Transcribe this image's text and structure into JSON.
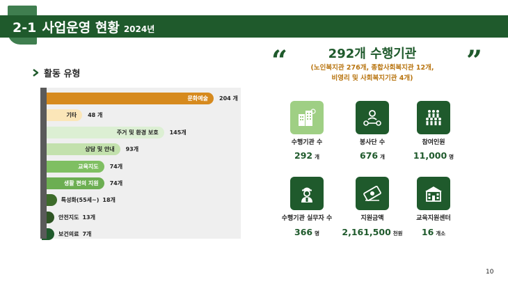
{
  "header": {
    "number": "2-1",
    "title": "사업운영 현황",
    "year": "2024년"
  },
  "section": {
    "label": "활동 유형"
  },
  "chart_data": {
    "type": "bar",
    "title": "",
    "categories": [
      "문화예술",
      "기타",
      "주거 및 환경 보호",
      "상담 및 안내",
      "교육지도",
      "생활 편의 지원",
      "특성화(55세~)",
      "안전지도",
      "보건의료"
    ],
    "values": [
      204,
      48,
      145,
      93,
      74,
      74,
      18,
      13,
      7
    ],
    "value_labels": [
      "204 개",
      "48 개",
      "145개",
      "93개",
      "74개",
      "74개",
      "18개",
      "13개",
      "7개"
    ],
    "colors": [
      "#d68a1e",
      "#fbe6b8",
      "#dcefd3",
      "#c3e1ad",
      "#7fbf62",
      "#6cae52",
      "#3d6b2a",
      "#2e5424",
      "#1f5a2c"
    ],
    "label_colors": [
      "#ffffff",
      "#222222",
      "#222222",
      "#222222",
      "#ffffff",
      "#ffffff",
      "#222222",
      "#222222",
      "#222222"
    ],
    "label_inside": [
      true,
      true,
      true,
      true,
      true,
      true,
      false,
      false,
      false
    ],
    "xlim": [
      0,
      204
    ],
    "grid": false
  },
  "summary": {
    "open_quote": "“",
    "close_quote": "”",
    "title": "292개 수행기관",
    "sub_line1": "(노인복지관 276개, 종합사회복지관 12개,",
    "sub_line2": "비영리 및 사회복지기관 4개)"
  },
  "stats": [
    {
      "label": "수행기관 수",
      "value": "292",
      "unit": "개",
      "icon": "buildings-icon",
      "color": "#9fcf84"
    },
    {
      "label": "봉사단 수",
      "value": "676",
      "unit": "개",
      "icon": "group-network-icon",
      "color": "#1f5a2c"
    },
    {
      "label": "참여인원",
      "value": "11,000",
      "unit": "명",
      "icon": "crowd-icon",
      "color": "#1f5a2c"
    },
    {
      "label": "수행기관 실무자 수",
      "value": "366",
      "unit": "명",
      "icon": "worker-icon",
      "color": "#1f5a2c"
    },
    {
      "label": "지원금액",
      "value": "2,161,500",
      "unit": "천원",
      "icon": "money-icon",
      "color": "#1f5a2c"
    },
    {
      "label": "교육지원센터",
      "value": "16",
      "unit": "개소",
      "icon": "school-building-icon",
      "color": "#1f5a2c"
    }
  ],
  "page": {
    "number": "10"
  }
}
